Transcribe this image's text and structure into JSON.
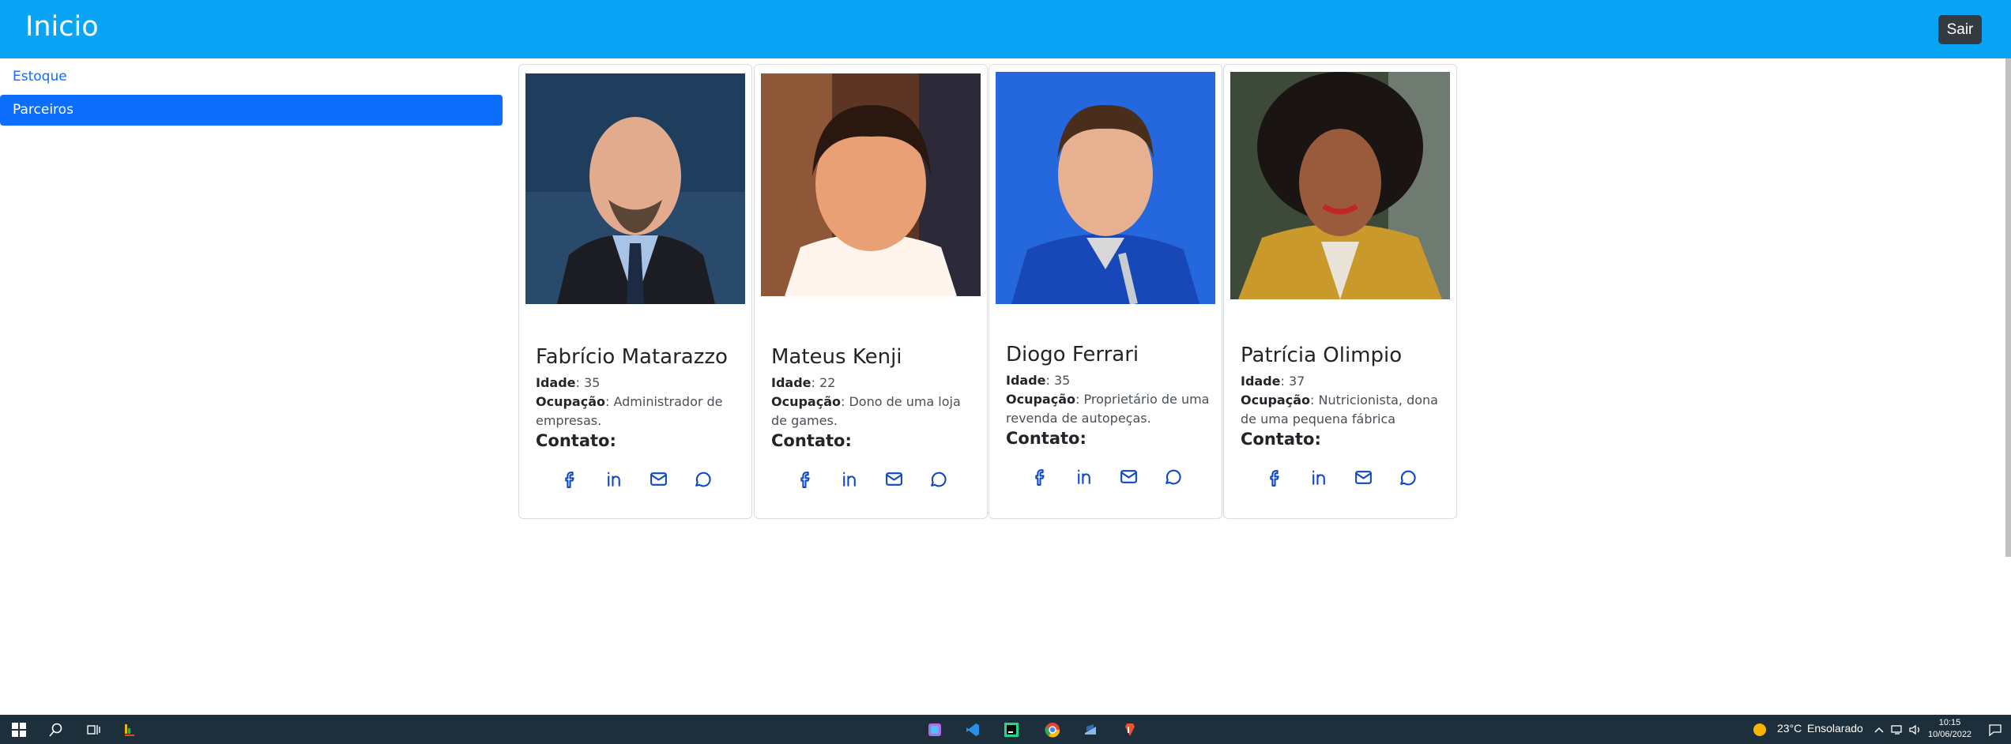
{
  "header": {
    "title": "Inicio",
    "logout_label": "Sair"
  },
  "sidebar": {
    "items": [
      {
        "label": "Estoque",
        "active": false
      },
      {
        "label": "Parceiros",
        "active": true
      }
    ]
  },
  "partners": [
    {
      "name": "Fabrício Matarazzo",
      "age_label": "Idade",
      "age": ": 35",
      "occupation_label": "Ocupação",
      "occupation": ": Administrador de empresas.",
      "contact_label": "Contato:"
    },
    {
      "name": "Mateus Kenji",
      "age_label": "Idade",
      "age": ": 22",
      "occupation_label": "Ocupação",
      "occupation": ": Dono de uma loja de games.",
      "contact_label": "Contato:"
    },
    {
      "name": "Diogo Ferrari",
      "age_label": "Idade",
      "age": ": 35",
      "occupation_label": "Ocupação",
      "occupation": ": Proprietário de uma revenda de autopeças.",
      "contact_label": "Contato:"
    },
    {
      "name": "Patrícia Olimpio",
      "age_label": "Idade",
      "age": ": 37",
      "occupation_label": "Ocupação",
      "occupation": ": Nutricionista, dona de uma pequena fábrica",
      "contact_label": "Contato:"
    }
  ],
  "contact_icons": [
    "facebook-icon",
    "linkedin-icon",
    "envelope-icon",
    "chat-icon"
  ],
  "taskbar": {
    "weather_temp": "23°C",
    "weather_text": "Ensolarado",
    "time": "10:15",
    "date": "10/06/2022"
  },
  "colors": {
    "navbar": "#0aa4f6",
    "primary": "#0d6efd",
    "logout_bg": "#343a40",
    "taskbar": "#1d2f3b",
    "icon_stroke": "#0d47c9"
  }
}
